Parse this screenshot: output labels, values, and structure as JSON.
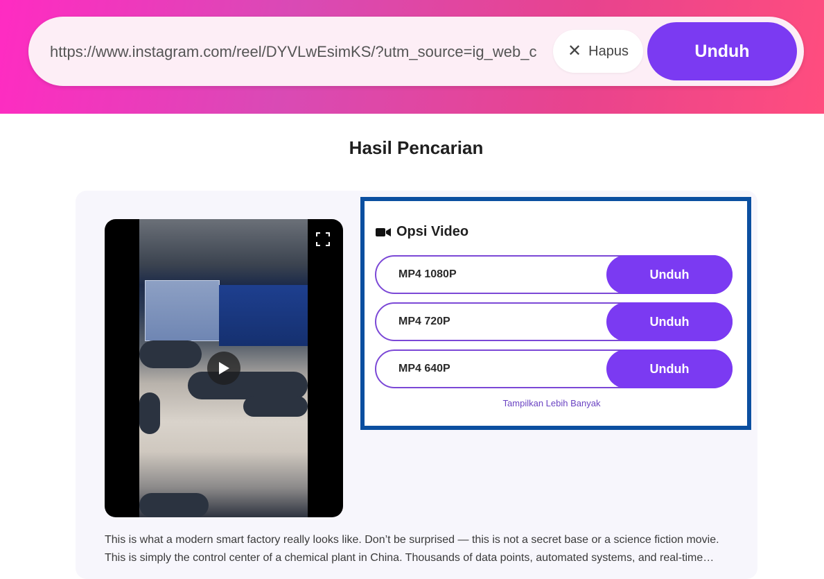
{
  "search": {
    "url_value": "https://www.instagram.com/reel/DYVLwEsimKS/?utm_source=ig_web_c",
    "clear_label": "Hapus",
    "download_label": "Unduh"
  },
  "results": {
    "title": "Hasil Pencarian",
    "options_title": "Opsi Video",
    "options": [
      {
        "format": "MP4 1080P",
        "button": "Unduh"
      },
      {
        "format": "MP4 720P",
        "button": "Unduh"
      },
      {
        "format": "MP4 640P",
        "button": "Unduh"
      }
    ],
    "show_more": "Tampilkan Lebih Banyak",
    "description_lines": [
      "This is what a modern smart factory really looks like. Don’t be surprised — this is not a secret base or a science fiction movie.",
      "This is simply the control center of a chemical plant in China. Thousands of data points, automated systems, and real-time…"
    ]
  },
  "icons": {
    "clear": "close-icon",
    "options": "video-camera-icon",
    "fullscreen": "fullscreen-icon",
    "play": "play-icon"
  },
  "colors": {
    "accent": "#7b3af2",
    "panel_border": "#0b4fa0",
    "header_gradient_start": "#ff2bc2",
    "header_gradient_end": "#ff4d7e"
  }
}
